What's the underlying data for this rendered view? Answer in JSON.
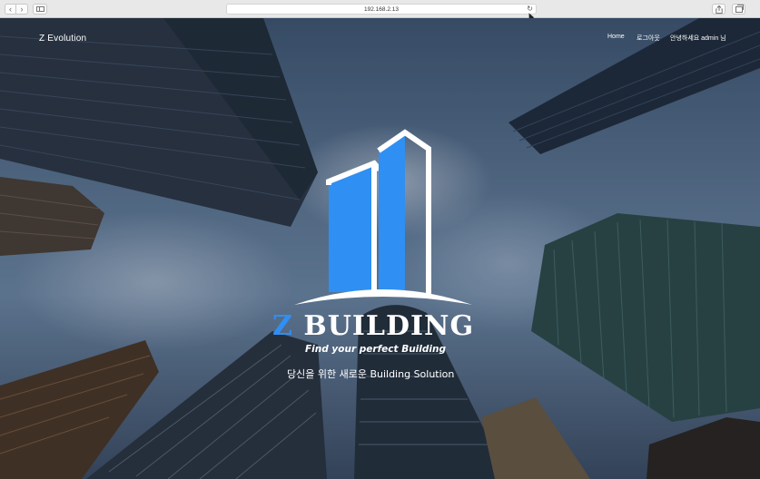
{
  "browser": {
    "url": "192.168.2.13",
    "icons": [
      "back-icon",
      "forward-icon",
      "sidebar-icon",
      "reload-icon",
      "share-icon",
      "tabs-icon"
    ]
  },
  "site": {
    "brand": "Z Evolution",
    "nav": {
      "home": "Home",
      "logout": "로그아웃",
      "greeting": "안녕하세요 admin 님"
    }
  },
  "hero": {
    "logo_z": "Z",
    "logo_word": "BUILDING",
    "tagline": "Find your perfect Building",
    "subtitle": "당신을 위한 새로운 Building Solution",
    "accent_color": "#2f8ff3"
  }
}
